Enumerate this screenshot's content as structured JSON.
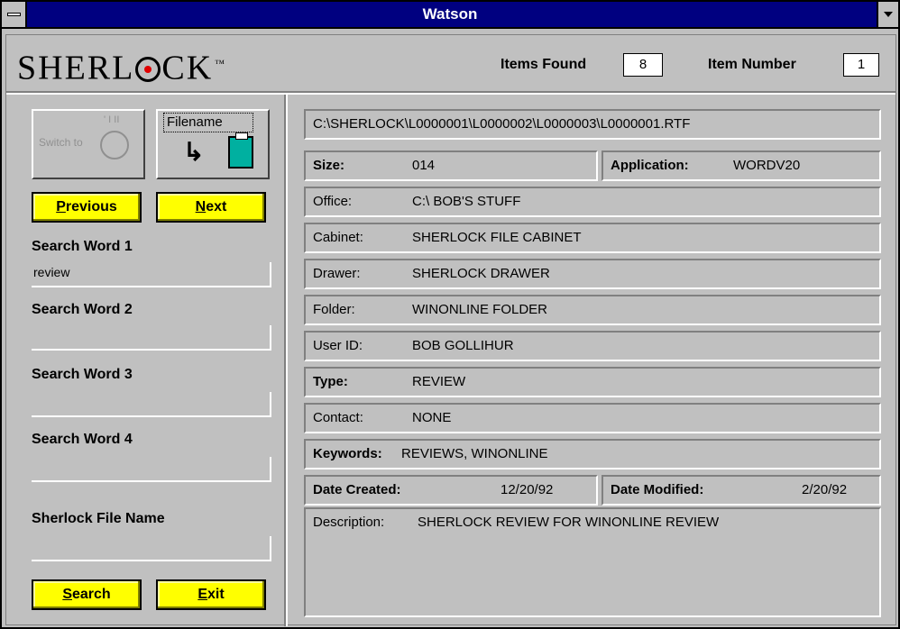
{
  "window": {
    "title": "Watson"
  },
  "header": {
    "logo_left": "SHERL",
    "logo_right": "CK",
    "logo_tm": "™",
    "items_found_label": "Items Found",
    "items_found_value": "8",
    "item_number_label": "Item Number",
    "item_number_value": "1"
  },
  "tools": {
    "switch_to_label": "Switch to",
    "switch_ticks": "' I  II",
    "filename_label": "Filename",
    "arrow_glyph": "↳"
  },
  "nav": {
    "previous_label_u": "P",
    "previous_label_rest": "revious",
    "next_label_u": "N",
    "next_label_rest": "ext"
  },
  "search": {
    "word1_label": "Search Word 1",
    "word1_value": "review",
    "word2_label": "Search Word 2",
    "word2_value": "",
    "word3_label": "Search Word 3",
    "word3_value": "",
    "word4_label": "Search Word 4",
    "word4_value": "",
    "filename_label": "Sherlock File Name",
    "filename_value": ""
  },
  "actions": {
    "search_label_u": "S",
    "search_label_rest": "earch",
    "exit_label_u": "E",
    "exit_label_rest": "xit"
  },
  "details": {
    "path": "C:\\SHERLOCK\\L0000001\\L0000002\\L0000003\\L0000001.RTF",
    "size_label": "Size:",
    "size_value": "014",
    "application_label": "Application:",
    "application_value": "WORDV20",
    "office_label": "Office:",
    "office_value": "C:\\ BOB'S STUFF",
    "cabinet_label": "Cabinet:",
    "cabinet_value": "SHERLOCK FILE CABINET",
    "drawer_label": "Drawer:",
    "drawer_value": "SHERLOCK DRAWER",
    "folder_label": "Folder:",
    "folder_value": "WINONLINE FOLDER",
    "userid_label": "User ID:",
    "userid_value": "BOB GOLLIHUR",
    "type_label": "Type:",
    "type_value": "REVIEW",
    "contact_label": "Contact:",
    "contact_value": "NONE",
    "keywords_label": "Keywords:",
    "keywords_value": "REVIEWS, WINONLINE",
    "created_label": "Date Created:",
    "created_value": "12/20/92",
    "modified_label": "Date Modified:",
    "modified_value": "2/20/92",
    "description_label": "Description:",
    "description_value": "SHERLOCK REVIEW FOR WINONLINE REVIEW"
  }
}
